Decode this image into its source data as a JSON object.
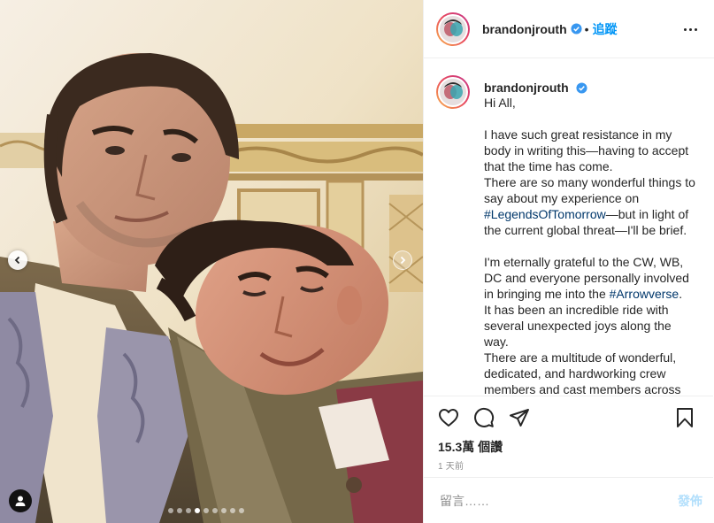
{
  "post": {
    "username": "brandonjrouth",
    "follow_label": "追蹤",
    "separator": "•",
    "caption_username": "brandonjrouth",
    "caption": [
      {
        "type": "text",
        "text": "Hi All,"
      },
      {
        "type": "gap"
      },
      {
        "type": "text",
        "text": "I have such great resistance in my body in writing this—having to accept that the time has come."
      },
      {
        "type": "text",
        "text": "There are so many wonderful things to say about my experience on "
      },
      {
        "type": "hashtag",
        "text": "#LegendsOfTomorrow"
      },
      {
        "type": "text",
        "text": "—but in light of the current global threat—I'll be brief."
      }
    ],
    "caption_part3_a": "I'm eternally grateful to the CW, WB, DC and everyone personally involved in bringing me into the ",
    "caption_part3_hashtag": "#Arrowverse",
    "caption_part3_b": ".",
    "caption_part4": "It has been an incredible ride with several unexpected joys along the way.",
    "caption_part5": "There are a multitude of wonderful, dedicated, and hardworking crew members and cast members across",
    "likes": "15.3萬 個讚",
    "time": "1 天前",
    "comment_placeholder": "留言……",
    "post_label": "發佈"
  },
  "carousel": {
    "slide_count": 9,
    "active_index": 3
  },
  "icons": {
    "verified": "verified-badge-icon",
    "more": "more-options-icon",
    "like": "heart-icon",
    "comment": "comment-icon",
    "share": "paper-plane-icon",
    "save": "bookmark-icon",
    "prev": "chevron-left-icon",
    "next": "chevron-right-icon",
    "tag": "user-tag-icon"
  },
  "colors": {
    "link": "#0095f6",
    "hashtag": "#00376b",
    "verified": "#3897f0",
    "secondary_text": "#8e8e8e"
  }
}
